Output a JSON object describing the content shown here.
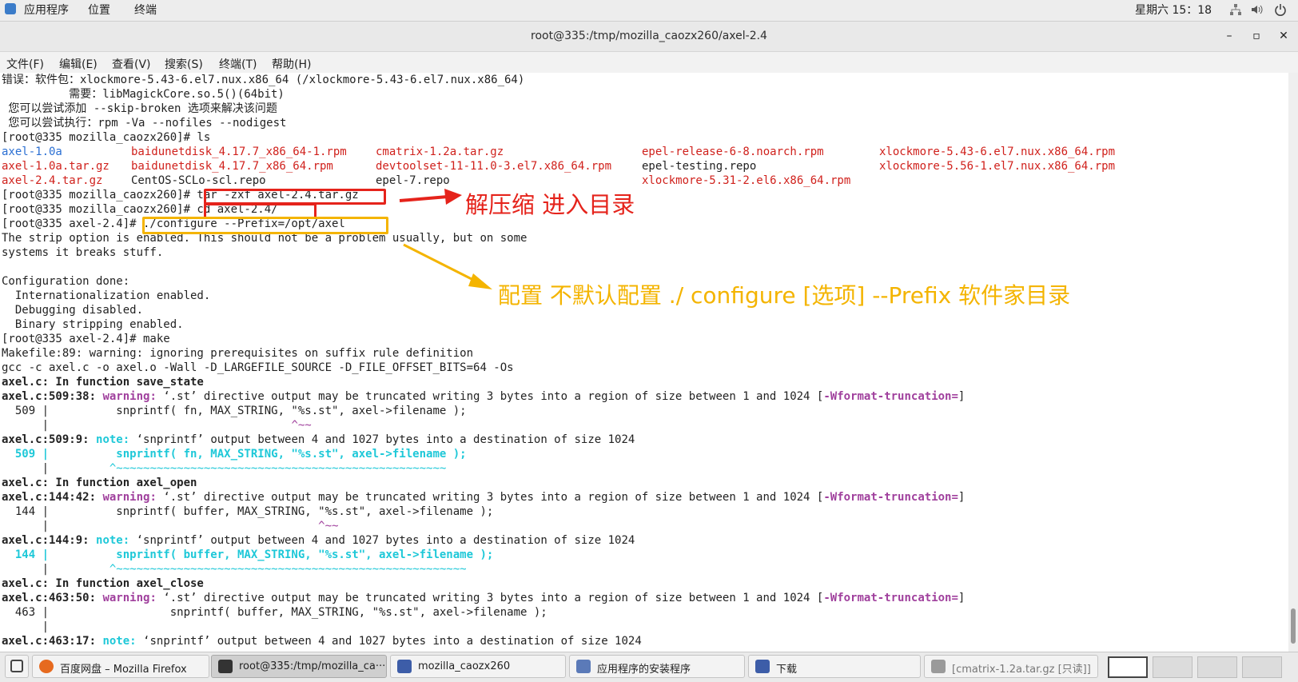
{
  "topbar": {
    "apps": "应用程序",
    "places": "位置",
    "terminal": "终端",
    "clock": "星期六 15：18"
  },
  "window": {
    "title": "root@335:/tmp/mozilla_caozx260/axel-2.4",
    "minimize": "–",
    "maximize": "▫",
    "close": "✕"
  },
  "menu": [
    "文件(F)",
    "编辑(E)",
    "查看(V)",
    "搜索(S)",
    "终端(T)",
    "帮助(H)"
  ],
  "terminal": {
    "l0": "错误：软件包：xlockmore-5.43-6.el7.nux.x86_64 (/xlockmore-5.43-6.el7.nux.x86_64)",
    "l1": "          需要：libMagickCore.so.5()(64bit)",
    "l2": " 您可以尝试添加 --skip-broken 选项来解决该问题",
    "l3": " 您可以尝试执行：rpm -Va --nofiles --nodigest",
    "l4": "[root@335 mozilla_caozx260]# ls",
    "ls": {
      "c1": [
        "axel-1.0a",
        "axel-1.0a.tar.gz",
        "axel-2.4.tar.gz"
      ],
      "c2": [
        "baidunetdisk_4.17.7_x86_64-1.rpm",
        "baidunetdisk_4.17.7_x86_64.rpm",
        "CentOS-SCLo-scl.repo"
      ],
      "c3": [
        "cmatrix-1.2a.tar.gz",
        "devtoolset-11-11.0-3.el7.x86_64.rpm",
        "epel-7.repo"
      ],
      "c4": [
        "epel-release-6-8.noarch.rpm",
        "epel-testing.repo",
        "xlockmore-5.31-2.el6.x86_64.rpm"
      ],
      "c5": [
        "xlockmore-5.43-6.el7.nux.x86_64.rpm",
        "xlockmore-5.56-1.el7.nux.x86_64.rpm",
        ""
      ]
    },
    "l8": "[root@335 mozilla_caozx260]# tar -zxf axel-2.4.tar.gz",
    "l9": "[root@335 mozilla_caozx260]# cd axel-2.4/",
    "l10": "[root@335 axel-2.4]# ./configure --Prefix=/opt/axel",
    "l11": "The strip option is enabled. This should not be a problem usually, but on some",
    "l12": "systems it breaks stuff.",
    "l14": "Configuration done:",
    "l15": "  Internationalization enabled.",
    "l16": "  Debugging disabled.",
    "l17": "  Binary stripping enabled.",
    "l18": "[root@335 axel-2.4]# make",
    "l19": "Makefile:89: warning: ignoring prerequisites on suffix rule definition",
    "l20": "gcc -c axel.c -o axel.o -Wall -D_LARGEFILE_SOURCE -D_FILE_OFFSET_BITS=64 -Os",
    "fn1": "save_state",
    "fn2": "axel_open",
    "fn3": "axel_close",
    "in_function": "axel.c: In function ",
    "warn_msg": " ‘.st’ directive output may be truncated writing 3 bytes into a region of size between 1 and 1024 [",
    "wflag": "-Wformat-truncation=",
    "note_msg": " ‘snprintf’ output between 4 and 1027 bytes into a destination of size 1024",
    "warning": "warning:",
    "note": "note:",
    "loc1w": "axel.c:509:38:",
    "loc1n": "axel.c:509:9:",
    "loc2w": "axel.c:144:42:",
    "loc2n": "axel.c:144:9:",
    "loc3w": "axel.c:463:50:",
    "loc3n": "axel.c:463:17:",
    "src1": "  509 |          snprintf( fn, MAX_STRING, \"%s.st\", axel->filename );",
    "src1b": "  509 |          snprintf( fn, MAX_STRING, \"%s.st\", axel->filename );",
    "src2": "  144 |          snprintf( buffer, MAX_STRING, \"%s.st\", axel->filename );",
    "src2b": "  144 |          snprintf( buffer, MAX_STRING, \"%s.st\", axel->filename );",
    "src3": "  463 |                  snprintf( buffer, MAX_STRING, \"%s.st\", axel->filename );",
    "bar": "      |"
  },
  "annotations": {
    "extract": "解压缩 进入目录",
    "configure": "配置 不默认配置 ./ configure [选项] --Prefix 软件家目录"
  },
  "colors": {
    "red_box": "#e5231b",
    "yellow_box": "#f4b400",
    "extract_text": "#e5231b",
    "configure_text": "#f4b400"
  },
  "taskbar": [
    {
      "label": "百度网盘 – Mozilla Firefox",
      "icon": "firefox-icon"
    },
    {
      "label": "root@335:/tmp/mozilla_ca···",
      "icon": "terminal-icon"
    },
    {
      "label": "mozilla_caozx260",
      "icon": "file-manager-icon"
    },
    {
      "label": "应用程序的安装程序",
      "icon": "installer-icon"
    },
    {
      "label": "下载",
      "icon": "file-manager-icon"
    },
    {
      "label": "[cmatrix-1.2a.tar.gz [只读]]",
      "icon": "archive-icon"
    }
  ]
}
